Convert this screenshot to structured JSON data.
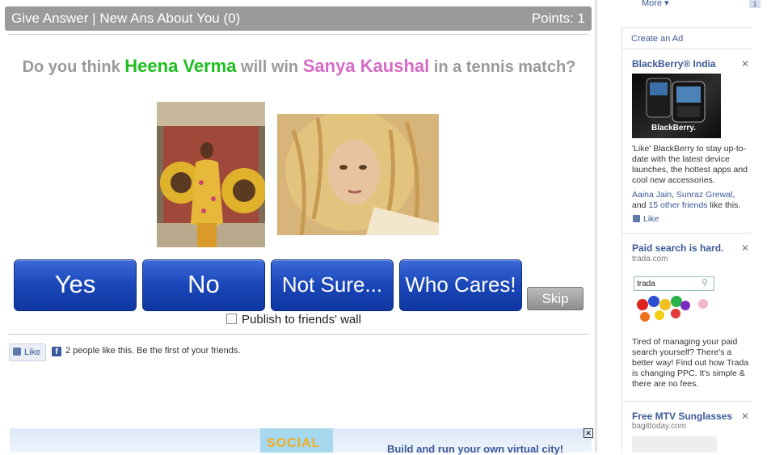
{
  "header": {
    "tab_give_answer": "Give Answer",
    "separator": "|",
    "tab_new_ans": "New Ans About You (0)",
    "points": "Points: 1"
  },
  "question": {
    "prefix": "Do you think",
    "person1": "Heena Verma",
    "middle": "will win",
    "person2": "Sanya Kaushal",
    "suffix": "in a tennis match?"
  },
  "colors": {
    "person1": "#1fbf1f",
    "person2": "#d46bc6",
    "button_blue": "#1a46b8",
    "header_gray": "#9a9a9a"
  },
  "answers": {
    "yes": "Yes",
    "no": "No",
    "not_sure": "Not Sure...",
    "who_cares": "Who Cares!",
    "skip": "Skip"
  },
  "publish_label": "Publish to friends' wall",
  "like_bar": {
    "button_label": "Like",
    "text": "2 people like this. Be the first of your friends."
  },
  "banner_ad": {
    "logo_text": "SOCIAL",
    "text": "Build and run your own virtual city!"
  },
  "sidebar": {
    "more": "More",
    "badge": "1",
    "create_ad": "Create an Ad",
    "ads": [
      {
        "title": "BlackBerry® India",
        "image_logo": "BlackBerry.",
        "body": "'Like' BlackBerry to stay up-to-date with the latest device launches, the hottest apps and cool new accessories.",
        "friends_1": "Aaina Jain",
        "friends_2": "Sunraz Grewal",
        "friends_and": ",",
        "friends_3": "15 other friends",
        "friends_tail": "like this.",
        "friends_lead": "and",
        "like": "Like"
      },
      {
        "title": "Paid search is hard.",
        "sub": "trada.com",
        "search_text": "trada",
        "body": "Tired of managing your paid search yourself? There's a better way! Find out how Trada is changing PPC. It's simple & there are no fees."
      },
      {
        "title": "Free MTV Sunglasses",
        "sub": "bagittoday.com"
      }
    ]
  }
}
